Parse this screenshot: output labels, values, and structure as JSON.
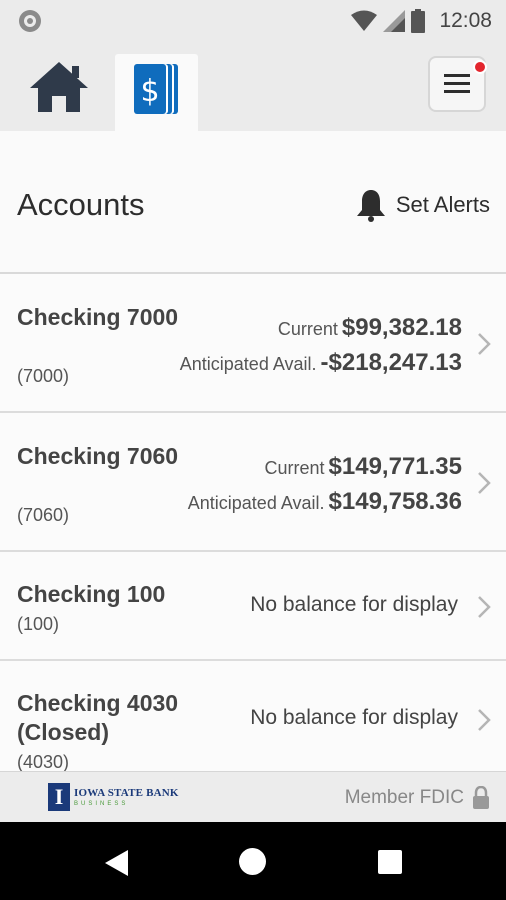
{
  "status_bar": {
    "time": "12:08",
    "icons": [
      "circle-notification-icon",
      "wifi-icon",
      "signal-icon",
      "battery-icon"
    ]
  },
  "tabs": [
    {
      "icon": "home-icon",
      "active": false
    },
    {
      "icon": "accounts-dollar-icon",
      "active": true
    }
  ],
  "menu": {
    "icon": "hamburger-menu-icon",
    "has_notification": true
  },
  "header": {
    "title": "Accounts",
    "set_alerts_label": "Set Alerts",
    "set_alerts_icon": "bell-icon"
  },
  "accounts": [
    {
      "name": "Checking 7000",
      "number": "(7000)",
      "current_label": "Current",
      "current": "$99,382.18",
      "anticipated_label": "Anticipated Avail.",
      "anticipated": "-$218,247.13"
    },
    {
      "name": "Checking 7060",
      "number": "(7060)",
      "current_label": "Current",
      "current": "$149,771.35",
      "anticipated_label": "Anticipated Avail.",
      "anticipated": "$149,758.36"
    },
    {
      "name": "Checking 100",
      "number": "(100)",
      "no_balance": "No balance for display"
    },
    {
      "name": "Checking 4030 (Closed)",
      "number": "(4030)",
      "no_balance": "No balance for display"
    }
  ],
  "footer": {
    "logo_mark": "I",
    "logo_name": "IOWA STATE BANK",
    "logo_sub": "BUSINESS",
    "member_fdic": "Member FDIC",
    "lock_icon": "lock-icon"
  },
  "colors": {
    "brand_blue": "#0f6cbd",
    "logo_navy": "#1b3a7a",
    "badge_red": "#e3262e",
    "text_dark": "#444444"
  }
}
